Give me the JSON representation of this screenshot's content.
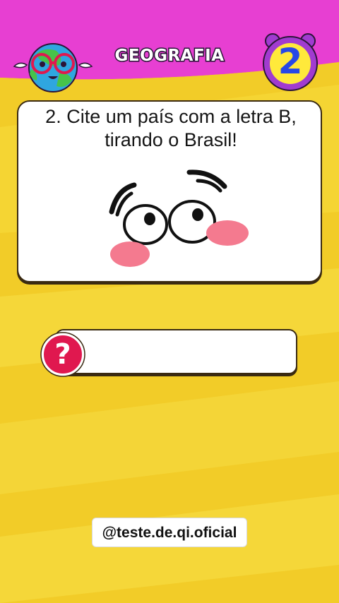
{
  "header": {
    "title": "GEOGRAFIA",
    "level_number": "2",
    "left_icon": "globe-mascot-icon",
    "right_icon": "alarm-clock-icon"
  },
  "question": {
    "text": "2. Cite um país com a letra B, tirando o Brasil!",
    "illustration": "surprised-face-icon"
  },
  "answer": {
    "value": "",
    "icon": "question-mark-icon"
  },
  "footer": {
    "handle": "@teste.de.qi.oficial"
  },
  "colors": {
    "header_bg": "#e73fd2",
    "background": "#f3cf2a",
    "question_badge": "#e0184f",
    "level_digit": "#2748e6",
    "clock_ring": "#a13bd0"
  }
}
